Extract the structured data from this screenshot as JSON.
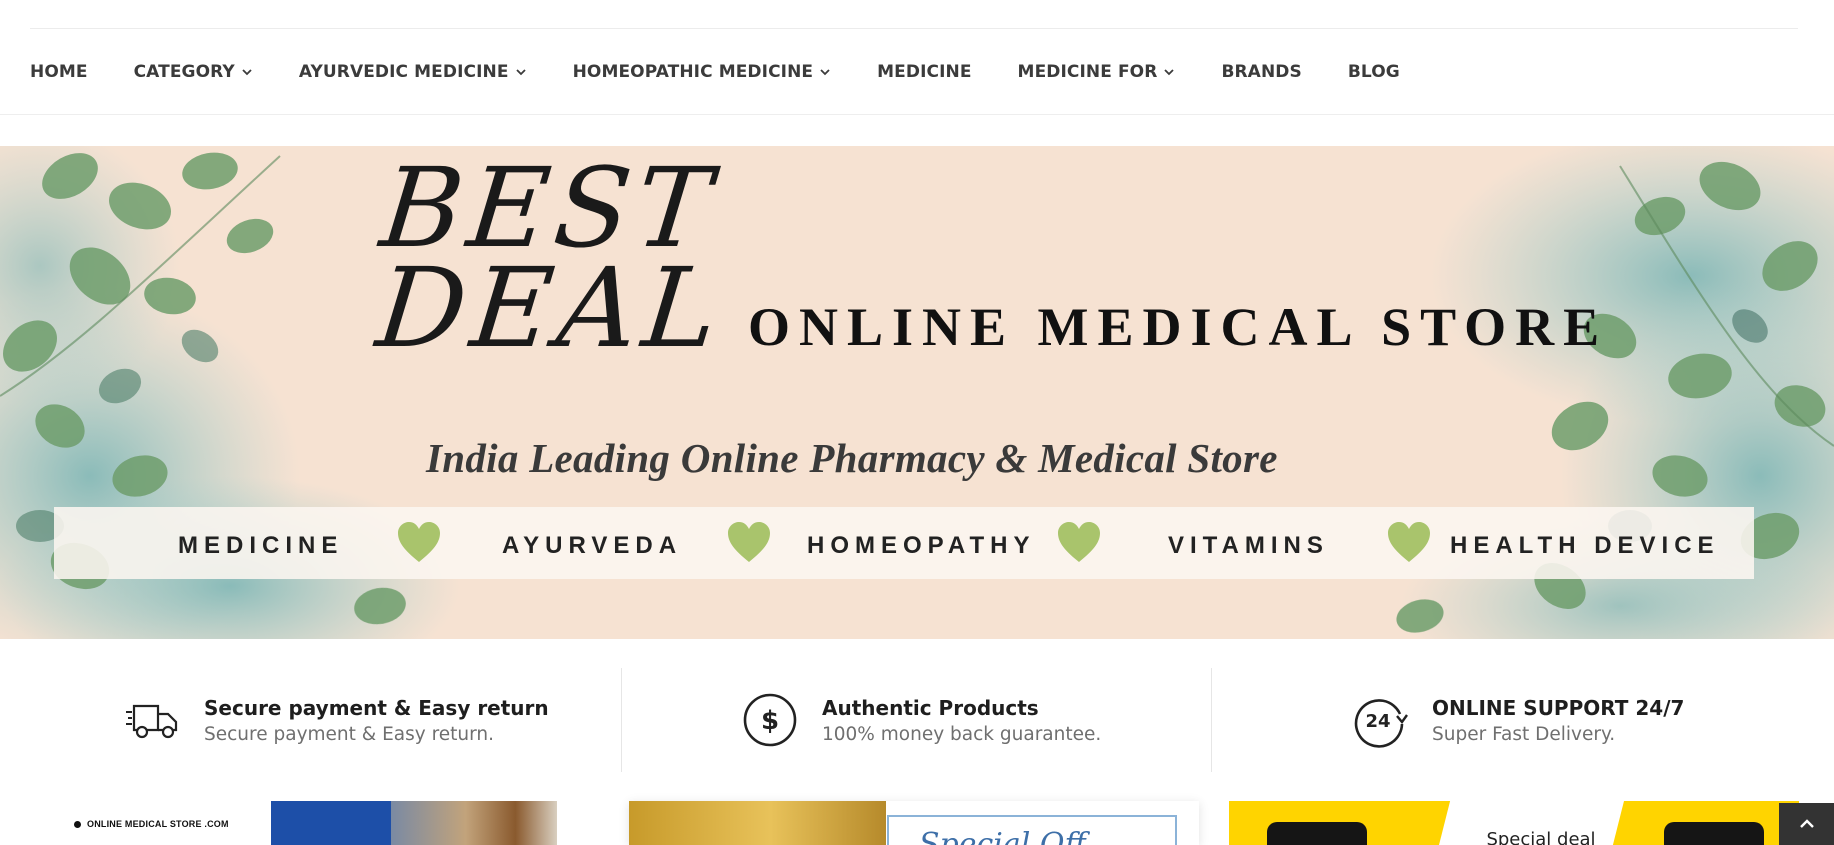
{
  "nav": {
    "items": [
      {
        "label": "HOME",
        "has_dropdown": false
      },
      {
        "label": "CATEGORY",
        "has_dropdown": true
      },
      {
        "label": "AYURVEDIC MEDICINE",
        "has_dropdown": true
      },
      {
        "label": "HOMEOPATHIC MEDICINE",
        "has_dropdown": true
      },
      {
        "label": "MEDICINE",
        "has_dropdown": false
      },
      {
        "label": "MEDICINE FOR",
        "has_dropdown": true
      },
      {
        "label": "BRANDS",
        "has_dropdown": false
      },
      {
        "label": "BLOG",
        "has_dropdown": false
      }
    ]
  },
  "banner": {
    "headline_line1": "BEST",
    "headline_line2": "DEAL",
    "store_name": "ONLINE MEDICAL STORE",
    "tagline": "India Leading Online Pharmacy & Medical Store",
    "strip_items": [
      "MEDICINE",
      "AYURVEDA",
      "HOMEOPATHY",
      "VITAMINS",
      "HEALTH DEVICE"
    ],
    "colors": {
      "background": "#f7e3d3",
      "leaf": "#6f9f73",
      "wash": "#8ec4c4",
      "heart": "#a9c46c"
    }
  },
  "features": [
    {
      "icon": "delivery-truck-icon",
      "title": "Secure payment & Easy return",
      "subtitle": "Secure payment & Easy return."
    },
    {
      "icon": "dollar-circle-icon",
      "title": "Authentic Products",
      "subtitle": "100% money back guarantee."
    },
    {
      "icon": "support-24-icon",
      "title": "ONLINE SUPPORT 24/7",
      "subtitle": "Super Fast Delivery."
    }
  ],
  "promos": {
    "card1_brand": "ONLINE MEDICAL STORE .COM",
    "card2_script": "Special Off",
    "card3_text": "Special deal"
  },
  "scroll_top_icon": "chevron-up-icon"
}
